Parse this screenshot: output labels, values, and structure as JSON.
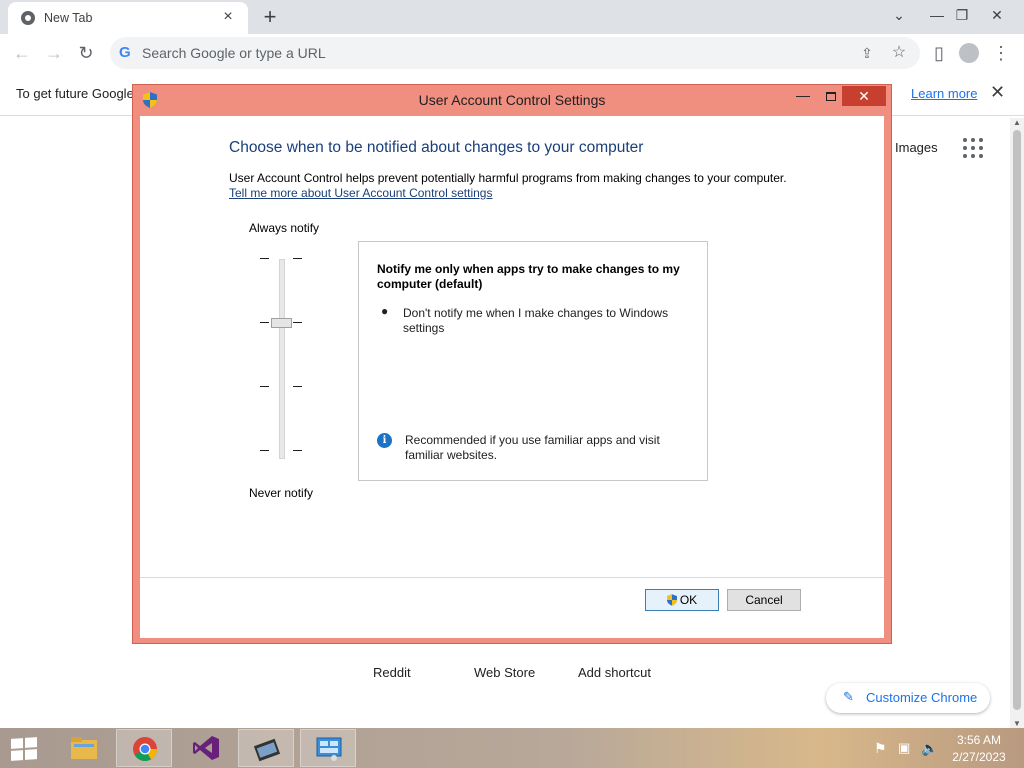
{
  "browser": {
    "tab_title": "New Tab",
    "tab_close": "×",
    "new_tab": "+",
    "omnibox_placeholder": "Search Google or type a URL",
    "omnibox_g": "G"
  },
  "infobar": {
    "text": "To get future Google",
    "link": "Learn more",
    "close": "✕"
  },
  "ntp": {
    "images_link": "Images",
    "shortcuts": [
      "Reddit",
      "Web Store",
      "Add shortcut"
    ],
    "customize_label": "Customize Chrome"
  },
  "uac": {
    "title": "User Account Control Settings",
    "heading": "Choose when to be notified about changes to your computer",
    "description": "User Account Control helps prevent potentially harmful programs from making changes to your computer.",
    "link": "Tell me more about User Account Control settings",
    "slider_top_label": "Always notify",
    "slider_bottom_label": "Never notify",
    "slider_level": 2,
    "slider_levels": 4,
    "box_title": "Notify me only when apps try to make changes to my computer (default)",
    "box_bullet": "Don't notify me when I make changes to Windows settings",
    "box_info": "Recommended if you use familiar apps and visit familiar websites.",
    "ok_label": "OK",
    "cancel_label": "Cancel",
    "close_glyph": "✕"
  },
  "taskbar": {
    "time": "3:56 AM",
    "date": "2/27/2023"
  },
  "colors": {
    "dialog_frame": "#f08e80",
    "dialog_close": "#c7402f",
    "link_blue": "#1a73e8",
    "heading_blue": "#1a3f7a"
  }
}
